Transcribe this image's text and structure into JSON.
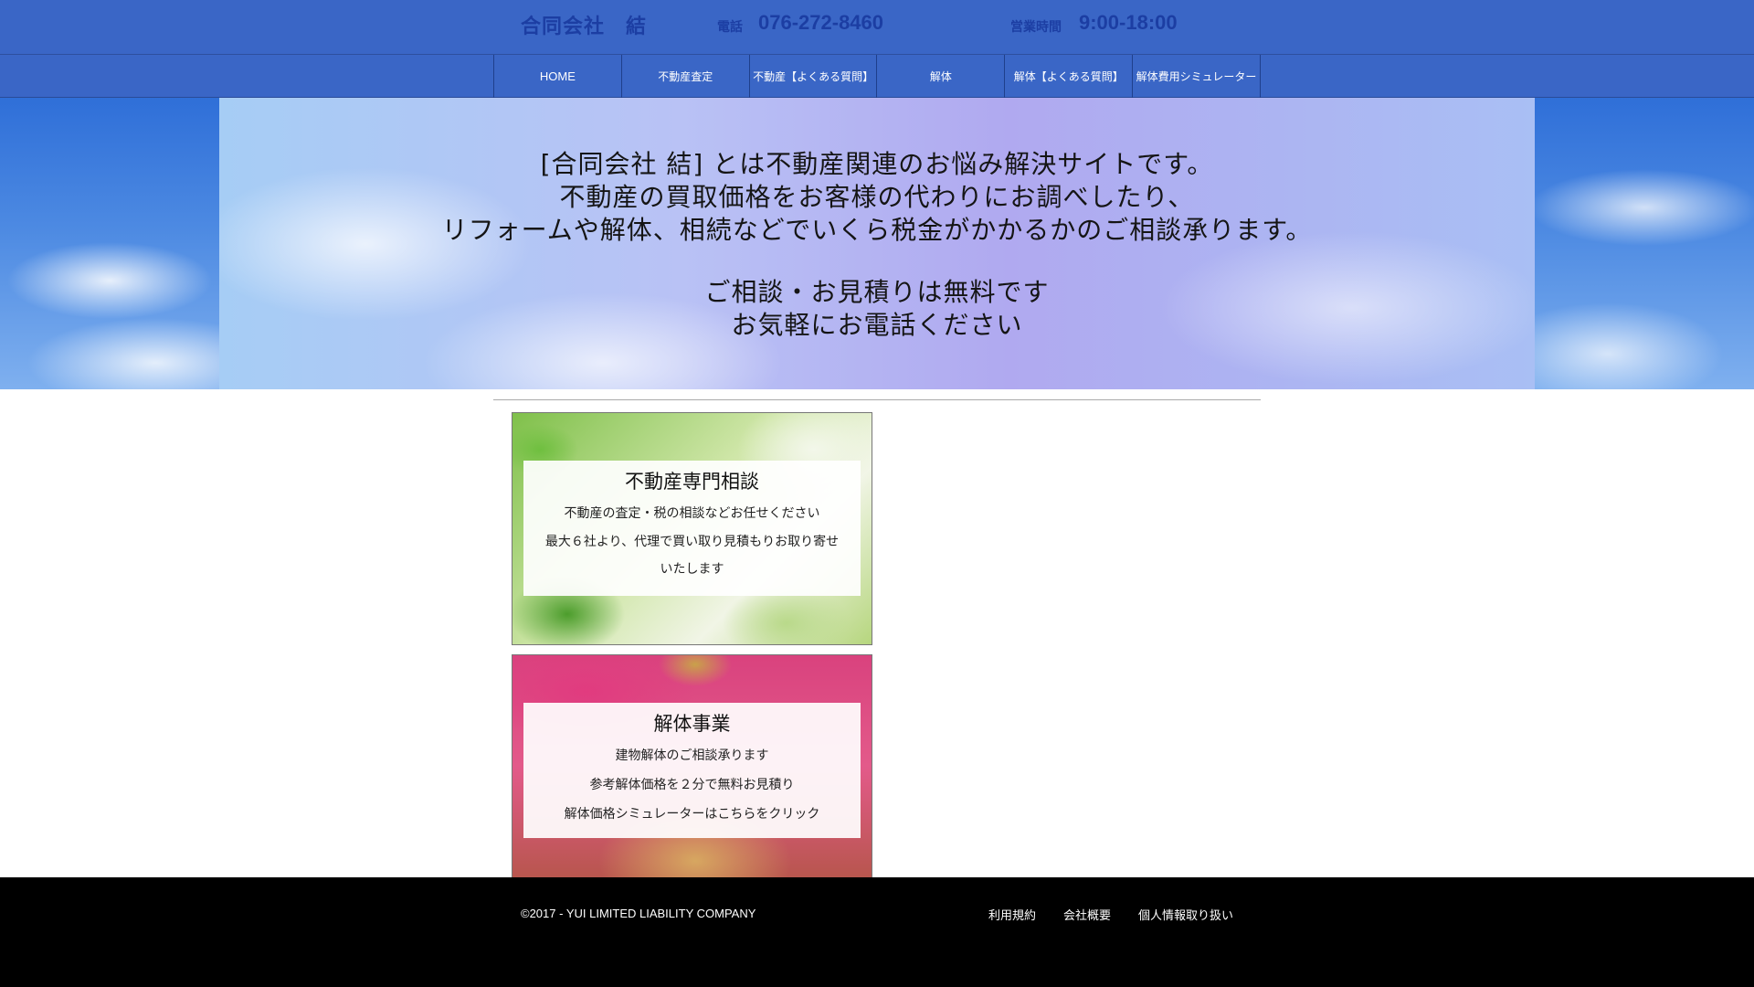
{
  "header": {
    "company": "合同会社　結",
    "tel_label": "電話",
    "tel_value": "076-272-8460",
    "hours_label": "営業時間",
    "hours_value": "9:00-18:00"
  },
  "nav": {
    "items": [
      {
        "label": "HOME"
      },
      {
        "label": "不動産査定"
      },
      {
        "label": "不動産【よくある質問】"
      },
      {
        "label": "解体"
      },
      {
        "label": "解体【よくある質問】"
      },
      {
        "label": "解体費用シミュレーター"
      }
    ]
  },
  "hero": {
    "line1": "[合同会社 結] とは不動産関連のお悩み解決サイトです。",
    "line2": "不動産の買取価格をお客様の代わりにお調べしたり、",
    "line3": "リフォームや解体、相続などでいくら税金がかかるかのご相談承ります。",
    "line4": "ご相談・お見積りは無料です",
    "line5": "お気軽にお電話ください"
  },
  "cards": [
    {
      "title": "不動産専門相談",
      "lines": [
        "不動産の査定・税の相談などお任せください",
        "最大６社より、代理で買い取り見積もりお取り寄せ",
        "いたします"
      ]
    },
    {
      "title": "解体事業",
      "lines": [
        "建物解体のご相談承ります",
        "参考解体価格を２分で無料お見積り",
        "解体価格シミュレーターはこちらをクリック"
      ]
    }
  ],
  "footer": {
    "copyright": "©2017 - YUI LIMITED LIABILITY COMPANY",
    "links": [
      {
        "label": "利用規約"
      },
      {
        "label": "会社概要"
      },
      {
        "label": "個人情報取り扱い"
      }
    ]
  }
}
